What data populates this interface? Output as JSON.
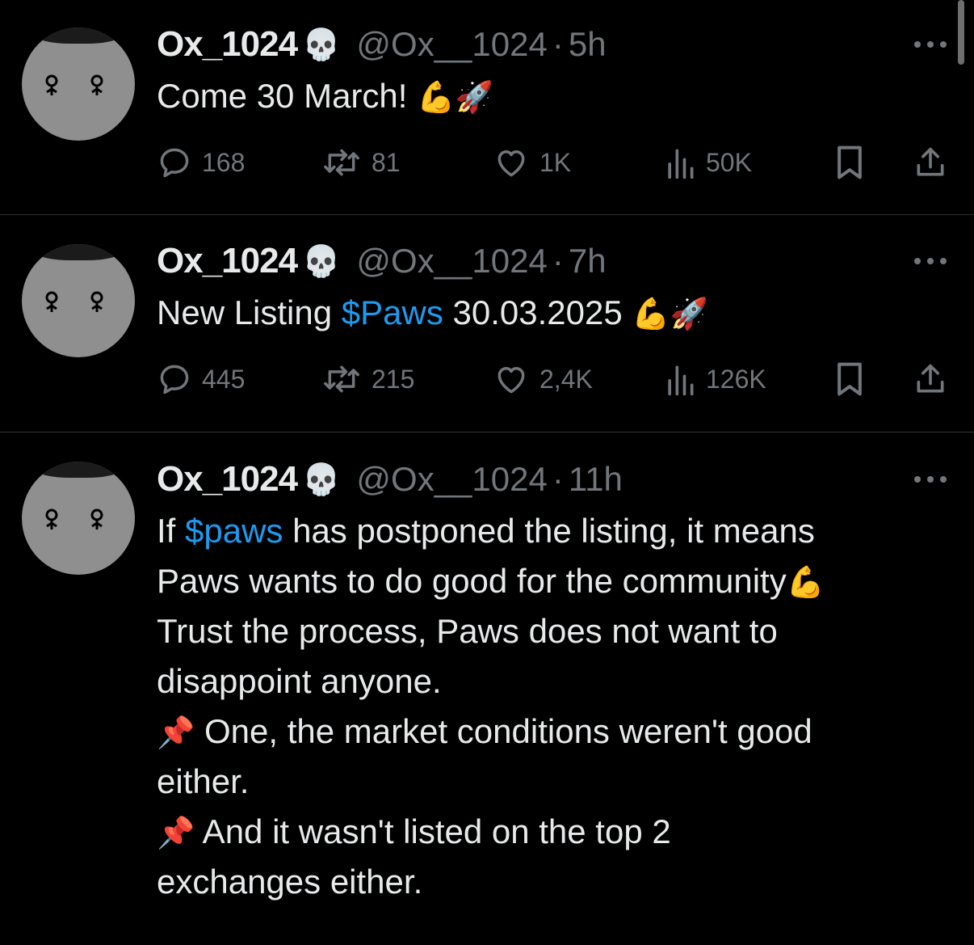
{
  "tweets": [
    {
      "name": "Ox_1024",
      "name_emoji": "💀",
      "handle": "@Ox__1024",
      "sep": "·",
      "time": "5h",
      "lines": [
        [
          {
            "t": "Come 30 March! "
          },
          {
            "t": "💪🚀",
            "emoji": true
          }
        ]
      ],
      "metrics": {
        "replies": "168",
        "reposts": "81",
        "likes": "1K",
        "views": "50K"
      }
    },
    {
      "name": "Ox_1024",
      "name_emoji": "💀",
      "handle": "@Ox__1024",
      "sep": "·",
      "time": "7h",
      "lines": [
        [
          {
            "t": "New Listing "
          },
          {
            "t": "$Paws",
            "cashtag": true
          },
          {
            "t": " 30.03.2025 "
          },
          {
            "t": "💪🚀",
            "emoji": true
          }
        ]
      ],
      "metrics": {
        "replies": "445",
        "reposts": "215",
        "likes": "2,4K",
        "views": "126K"
      }
    },
    {
      "name": "Ox_1024",
      "name_emoji": "💀",
      "handle": "@Ox__1024",
      "sep": "·",
      "time": "11h",
      "lines": [
        [
          {
            "t": "If "
          },
          {
            "t": "$paws",
            "cashtag": true
          },
          {
            "t": " has postponed the listing, it means"
          }
        ],
        [
          {
            "t": "Paws wants to do good for the community"
          },
          {
            "t": "💪",
            "emoji": true
          }
        ],
        [
          {
            "t": "Trust the process, Paws does not want to"
          }
        ],
        [
          {
            "t": "disappoint anyone."
          }
        ],
        [
          {
            "t": "📌",
            "emoji": true
          },
          {
            "t": " One, the market conditions weren't good"
          }
        ],
        [
          {
            "t": "either."
          }
        ],
        [
          {
            "t": "📌",
            "emoji": true
          },
          {
            "t": " And it wasn't listed on the top 2"
          }
        ],
        [
          {
            "t": "exchanges either."
          }
        ]
      ],
      "metrics": null
    }
  ],
  "icons": [
    "skull-emoji",
    "reply-icon",
    "repost-icon",
    "like-icon",
    "views-icon",
    "bookmark-icon",
    "share-icon",
    "more-icon"
  ],
  "colors": {
    "background": "#000000",
    "text": "#e7e9ea",
    "secondary": "#71767b",
    "link": "#1d9bf0",
    "divider": "#2f3336"
  }
}
